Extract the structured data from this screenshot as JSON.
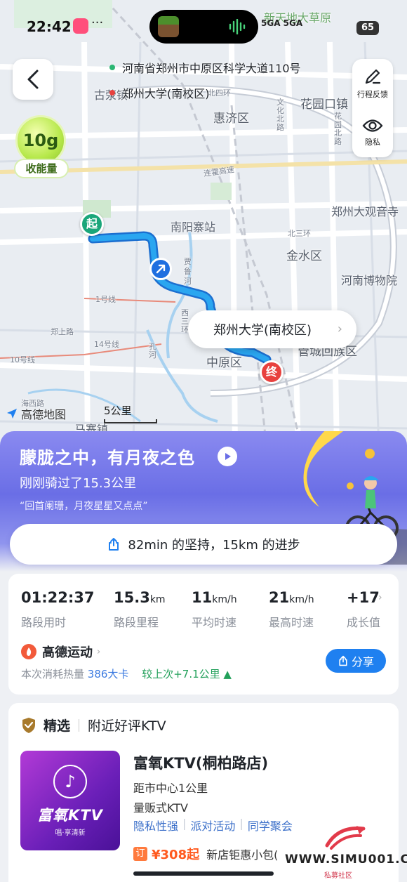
{
  "status": {
    "time": "22:42",
    "dots": "···",
    "network": "5GA 5GA",
    "battery": "65"
  },
  "map": {
    "route_start": "河南省郑州市中原区科学大道110号",
    "route_end": "郑州大学(南校区)",
    "start_pin": "起",
    "end_pin": "终",
    "dest_bubble": "郑州大学(南校区)",
    "labels": {
      "xintiandi": "新天地大草原",
      "guxingzhen": "古荥镇",
      "beisihuan": "北四环",
      "huayuankou": "花园口镇",
      "huijiqu": "惠济区",
      "wenhua": "文化北路",
      "huayuan": "花园北路",
      "lianhuo": "连霍高速",
      "nanyangzhai": "南阳寨站",
      "daguansi": "郑州大观音寺",
      "beisanhuan": "北三环",
      "jinshuiqu": "金水区",
      "museum": "河南博物院",
      "jialuhe": "贾鲁河",
      "xisanhuan": "西三环",
      "line1": "1号线",
      "zhengshang": "郑上路",
      "line14": "14号线",
      "line10": "10号线",
      "kongqu": "孔河",
      "zhongyuanqu": "中原区",
      "guanchengqu": "管城回族区",
      "majiazhen": "马寨镇",
      "haiyu": "海西路"
    },
    "logo": "高德地图",
    "scale": "5公里"
  },
  "side_tools": {
    "feedback": "行程反馈",
    "privacy": "隐私"
  },
  "energy": {
    "amount": "10g",
    "label": "收能量"
  },
  "banner": {
    "title": "朦胧之中，有月夜之色",
    "subtitle": "刚刚骑过了15.3公里",
    "quote": "“回首阑珊，月夜星星又点点”"
  },
  "share_pill": "82min 的坚持，15km 的进步",
  "stats": [
    {
      "value": "01:22:37",
      "unit": "",
      "label": "路段用时"
    },
    {
      "value": "15.3",
      "unit": "km",
      "label": "路段里程"
    },
    {
      "value": "11",
      "unit": "km/h",
      "label": "平均时速"
    },
    {
      "value": "21",
      "unit": "km/h",
      "label": "最高时速"
    },
    {
      "value": "+17",
      "unit": "",
      "label": "成长值"
    }
  ],
  "sport": {
    "title": "高德运动",
    "kcal_prefix": "本次消耗热量",
    "kcal_value": "386大卡",
    "compare": "较上次+7.1公里 ▲",
    "share": "分享"
  },
  "ktv": {
    "section_tag": "精选",
    "section_title": "附近好评KTV",
    "img_brand": "富氧KTV",
    "img_slogan": "唱·享清新",
    "name": "富氧KTV(桐柏路店)",
    "distance": "距市中心1公里",
    "type": "量贩式KTV",
    "tags": [
      "隐私性强",
      "派对活动",
      "同学聚会"
    ],
    "price_tag": "订",
    "price": "¥308起",
    "price_desc": "新店钜惠小包("
  },
  "watermark": {
    "text": "WWW.SIMU001.CN",
    "sub": "私募社区"
  },
  "colors": {
    "route": "#2aa6f0",
    "primary_blue": "#1f80f0",
    "banner_purple": "#6a6ee6",
    "start_green": "#1aa67a",
    "end_red": "#e8413e"
  }
}
